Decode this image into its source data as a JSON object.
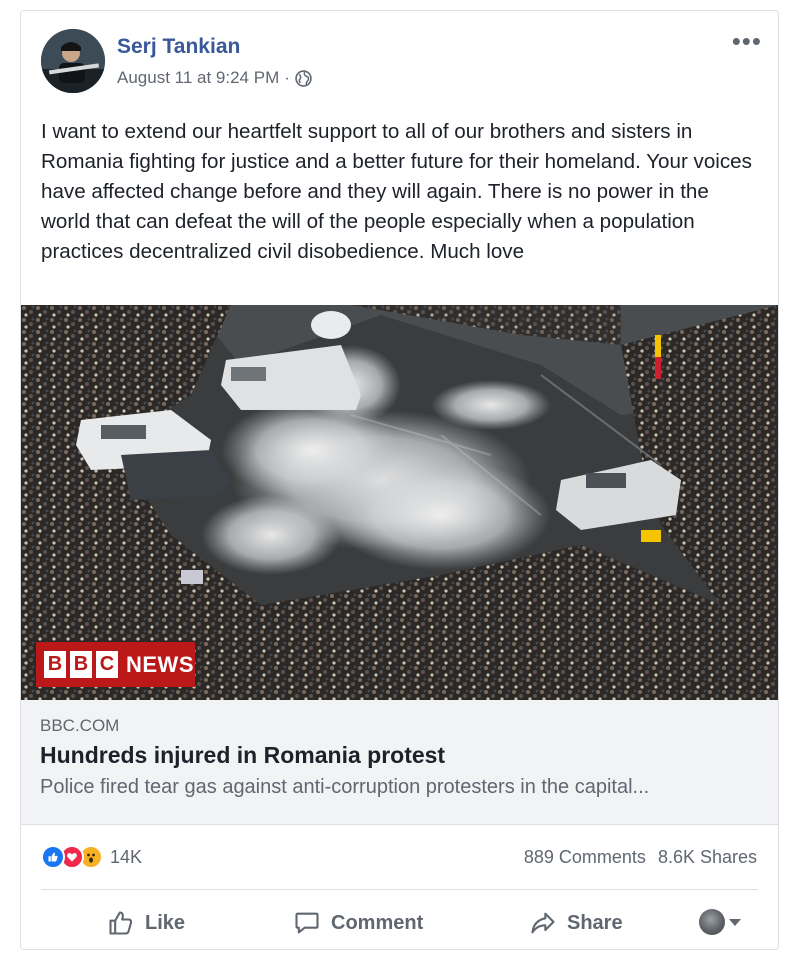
{
  "post": {
    "author": "Serj Tankian",
    "timestamp": "August 11 at 9:24 PM",
    "separator": "·",
    "audience_icon": "globe-icon",
    "more_icon": "more-options-icon",
    "text": "I want to extend our heartfelt support to all of our brothers and sisters in Romania fighting for justice and a better future for their homeland. Your voices have affected change before and they will again. There is no power in the world that can defeat the will of the people especially when a population practices decentralized civil disobedience. Much love"
  },
  "link_preview": {
    "badge_letters": [
      "B",
      "B",
      "C"
    ],
    "badge_word": "NEWS",
    "source": "BBC.COM",
    "title": "Hundreds injured in Romania protest",
    "description": "Police fired tear gas against anti-corruption protesters in the capital..."
  },
  "engagement": {
    "reaction_icons": [
      "like-reaction-icon",
      "love-reaction-icon",
      "wow-reaction-icon"
    ],
    "reaction_count": "14K",
    "comments": "889 Comments",
    "shares": "8.6K Shares"
  },
  "actions": {
    "like": "Like",
    "comment": "Comment",
    "share": "Share"
  },
  "colors": {
    "author_link": "#385898",
    "secondary_text": "#606770",
    "bbc_red": "#bb1919",
    "like_blue": "#1877f2",
    "love_red": "#f0284a",
    "wow_yellow": "#f7b125"
  }
}
